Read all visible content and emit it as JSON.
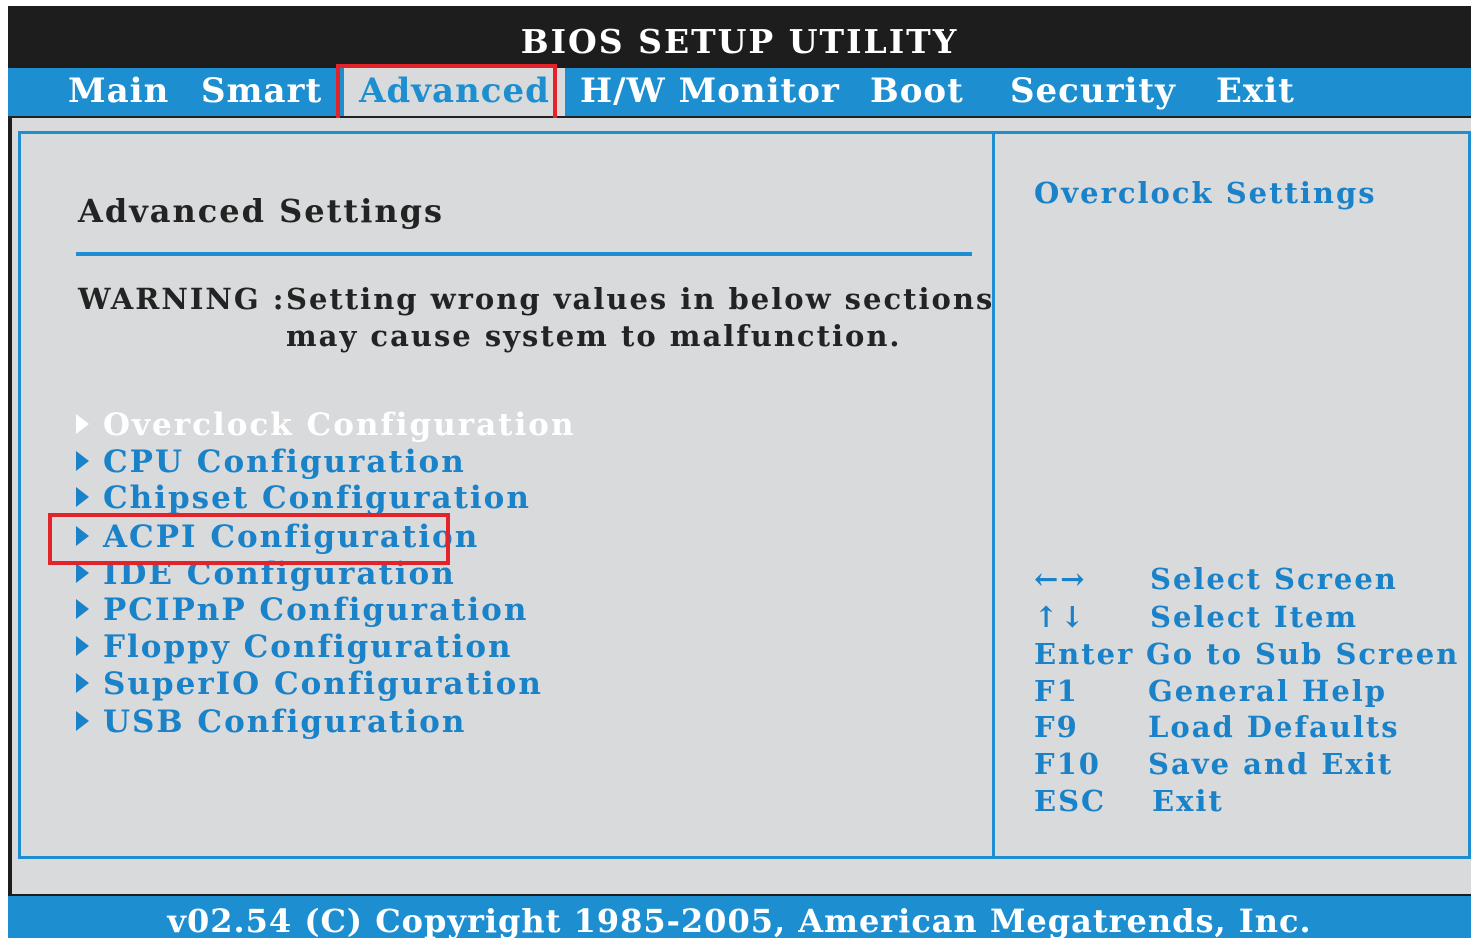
{
  "window": {
    "title": "BIOS SETUP UTILITY"
  },
  "menu": {
    "tabs": [
      "Main",
      "Smart",
      "Advanced",
      "H/W Monitor",
      "Boot",
      "Security",
      "Exit"
    ],
    "active": "Advanced"
  },
  "main": {
    "heading": "Advanced Settings",
    "warning_label": "WARNING :",
    "warning_line1": "Setting wrong values in below sections",
    "warning_line2": "may cause system to malfunction.",
    "items": [
      "Overclock Configuration",
      "CPU Configuration",
      "Chipset Configuration",
      "ACPI Configuration",
      "IDE Configuration",
      "PCIPnP Configuration",
      "Floppy Configuration",
      "SuperIO Configuration",
      "USB Configuration"
    ],
    "selected_item": "Overclock Configuration",
    "highlighted_item": "ACPI Configuration"
  },
  "help": {
    "title": "Overclock Settings",
    "keys": [
      {
        "key": "←→",
        "desc": "Select Screen"
      },
      {
        "key": "↑↓",
        "desc": "Select Item"
      },
      {
        "key": "Enter",
        "desc": "Go to Sub Screen"
      },
      {
        "key": "F1",
        "desc": "General Help"
      },
      {
        "key": "F9",
        "desc": "Load Defaults"
      },
      {
        "key": "F10",
        "desc": "Save and Exit"
      },
      {
        "key": "ESC",
        "desc": "Exit"
      }
    ]
  },
  "footer": {
    "text": "v02.54 (C) Copyright 1985-2005, American Megatrends, Inc."
  },
  "colors": {
    "accent": "#1d8fd1",
    "highlight_box": "#e2232a",
    "panel": "#d8dadb",
    "frame": "#1d1d1d"
  }
}
